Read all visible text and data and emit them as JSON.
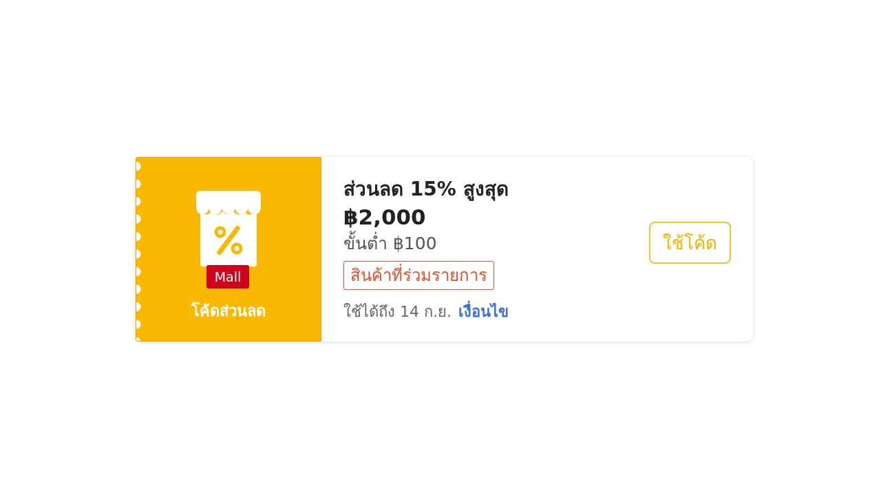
{
  "coupon": {
    "badge": {
      "brand": "Mall",
      "label": "โค้ดส่วนลด"
    },
    "title": "ส่วนลด 15% สูงสุด",
    "amount": "฿2,000",
    "minimum": "ขั้นต่ำ ฿100",
    "tag": "สินค้าที่ร่วมรายการ",
    "validity": "ใช้ได้ถึง 14 ก.ย.",
    "terms_link": "เงื่อนไข",
    "action": "ใช้โค้ด"
  }
}
